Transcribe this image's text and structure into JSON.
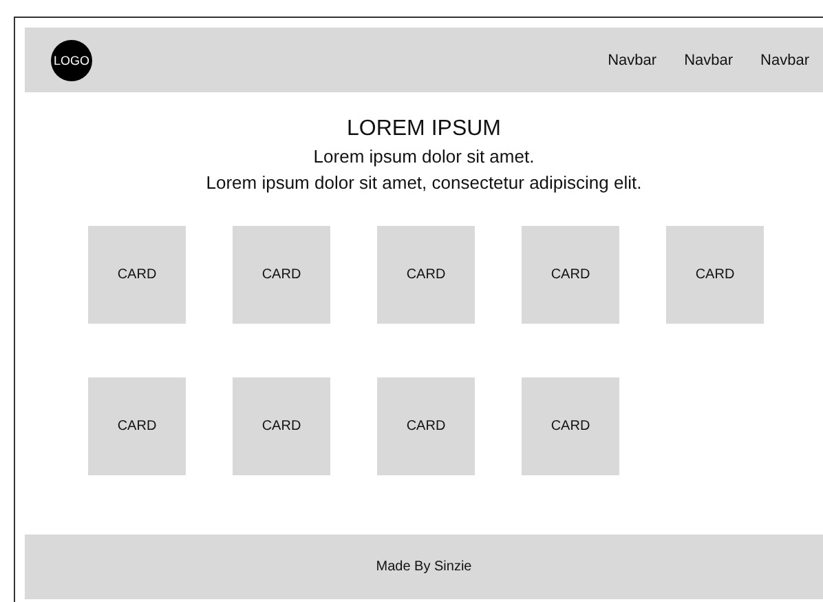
{
  "navbar": {
    "logo": "LOGO",
    "links": [
      "Navbar",
      "Navbar",
      "Navbar"
    ]
  },
  "hero": {
    "title": "LOREM IPSUM",
    "subtitle": "Lorem ipsum dolor sit amet.",
    "text": "Lorem ipsum dolor sit amet, consectetur adipiscing elit."
  },
  "cards": [
    "CARD",
    "CARD",
    "CARD",
    "CARD",
    "CARD",
    "CARD",
    "CARD",
    "CARD",
    "CARD"
  ],
  "footer": {
    "text": "Made By Sinzie"
  }
}
